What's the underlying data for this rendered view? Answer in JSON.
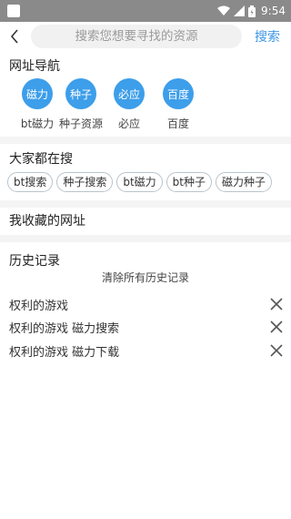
{
  "status": {
    "time": "9:54"
  },
  "header": {
    "back_icon": "chevron-left-icon",
    "search_placeholder": "搜索您想要寻找的资源",
    "search_label": "搜索",
    "accent_color": "#3d97e8"
  },
  "nav": {
    "title": "网址导航",
    "items": [
      {
        "circle": "磁力",
        "label": "bt磁力"
      },
      {
        "circle": "种子",
        "label": "种子资源"
      },
      {
        "circle": "必应",
        "label": "必应"
      },
      {
        "circle": "百度",
        "label": "百度"
      }
    ]
  },
  "popular": {
    "title": "大家都在搜",
    "tags": [
      "bt搜索",
      "种子搜索",
      "bt磁力",
      "bt种子",
      "磁力种子"
    ]
  },
  "favorites": {
    "title": "我收藏的网址"
  },
  "history": {
    "title": "历史记录",
    "clear_label": "清除所有历史记录",
    "items": [
      "权利的游戏",
      "权利的游戏 磁力搜索",
      "权利的游戏 磁力下载"
    ]
  }
}
